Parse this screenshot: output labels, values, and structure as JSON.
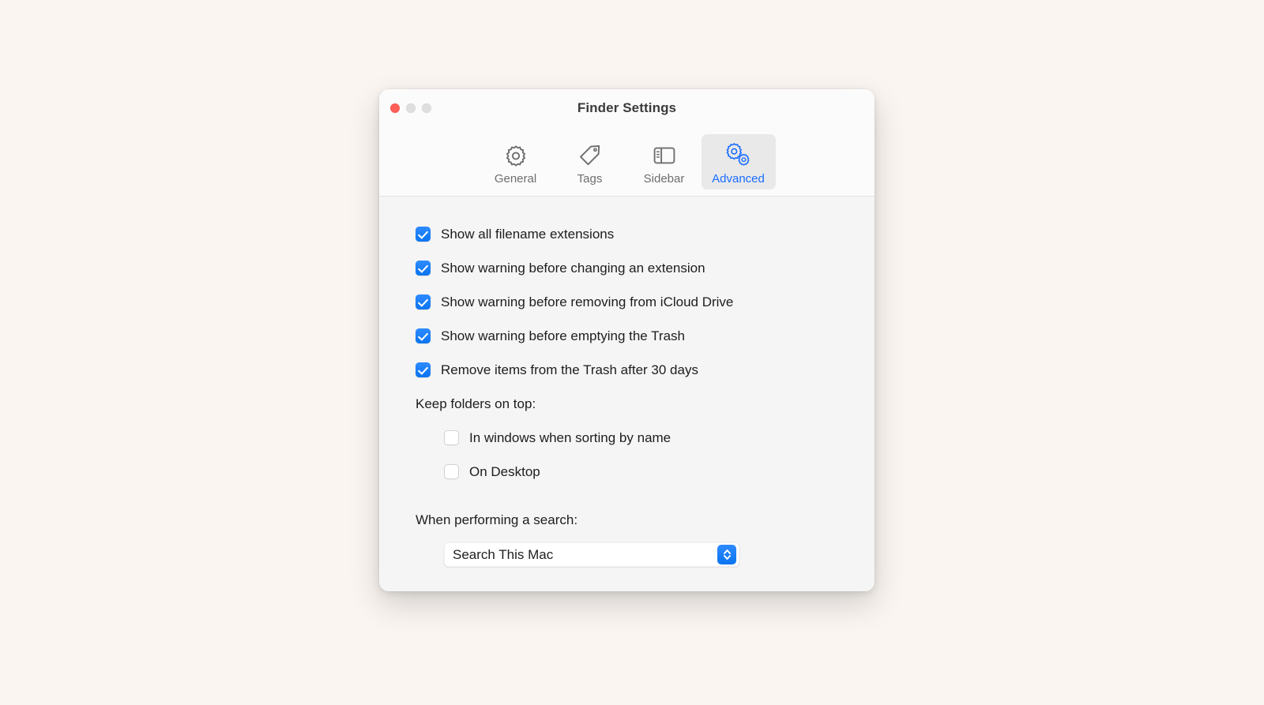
{
  "window": {
    "title": "Finder Settings",
    "traffic_lights": [
      {
        "name": "close",
        "color": "#ff5f57"
      },
      {
        "name": "minimize",
        "color": "#dedede"
      },
      {
        "name": "zoom",
        "color": "#dedede"
      }
    ]
  },
  "toolbar": {
    "tabs": [
      {
        "label": "General",
        "icon": "gear-icon",
        "selected": false
      },
      {
        "label": "Tags",
        "icon": "tag-icon",
        "selected": false
      },
      {
        "label": "Sidebar",
        "icon": "sidebar-icon",
        "selected": false
      },
      {
        "label": "Advanced",
        "icon": "double-gear-icon",
        "selected": true
      }
    ],
    "selected_tab": "Advanced",
    "accent_color": "#1a6dff",
    "selected_bg": "#e9e9e9"
  },
  "advanced": {
    "checkboxes": [
      {
        "label": "Show all filename extensions",
        "checked": true
      },
      {
        "label": "Show warning before changing an extension",
        "checked": true
      },
      {
        "label": "Show warning before removing from iCloud Drive",
        "checked": true
      },
      {
        "label": "Show warning before emptying the Trash",
        "checked": true
      },
      {
        "label": "Remove items from the Trash after 30 days",
        "checked": true
      }
    ],
    "keep_folders_group": {
      "label": "Keep folders on top:",
      "options": [
        {
          "label": "In windows when sorting by name",
          "checked": false
        },
        {
          "label": "On Desktop",
          "checked": false
        }
      ]
    },
    "search_group": {
      "label": "When performing a search:",
      "selected_value": "Search This Mac"
    }
  },
  "colors": {
    "page_background": "#faf5f1",
    "window_background": "#f5f5f5",
    "toolbar_background": "#fbfbfb",
    "checkbox_on": "#0a74f0",
    "text": "#1d1d1d"
  }
}
